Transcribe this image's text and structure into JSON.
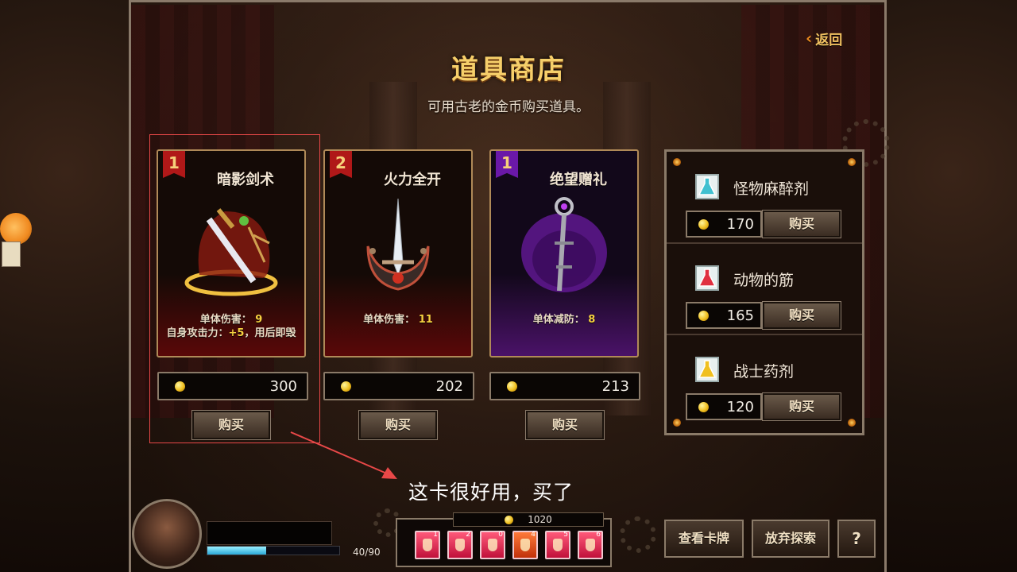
{
  "header": {
    "back_label": "返回",
    "title": "道具商店",
    "subtitle": "可用古老的金币购买道具。"
  },
  "cards": [
    {
      "rank": "1",
      "name": "暗影剑术",
      "theme": "red",
      "desc_line1_label": "单体伤害：",
      "desc_line1_value": "9",
      "desc_line2_label": "自身攻击力：",
      "desc_line2_value": "+5",
      "desc_line2_suffix": "，用后即毁",
      "price": "300",
      "buy_label": "购买",
      "icon": "shadow-sword-icon"
    },
    {
      "rank": "2",
      "name": "火力全开",
      "theme": "red",
      "desc_line1_label": "单体伤害：",
      "desc_line1_value": "11",
      "price": "202",
      "buy_label": "购买",
      "icon": "fire-blade-icon"
    },
    {
      "rank": "1",
      "name": "绝望赠礼",
      "theme": "purple",
      "desc_line1_label": "单体减防：",
      "desc_line1_value": "8",
      "price": "213",
      "buy_label": "购买",
      "icon": "despair-staff-icon"
    }
  ],
  "side_items": [
    {
      "name": "怪物麻醉剂",
      "price": "170",
      "buy_label": "购买",
      "potion_color": "#40c0d0"
    },
    {
      "name": "动物的筋",
      "price": "165",
      "buy_label": "购买",
      "potion_color": "#e03040"
    },
    {
      "name": "战士药剂",
      "price": "120",
      "buy_label": "购买",
      "potion_color": "#f0c020"
    }
  ],
  "annotation": "这卡很好用，买了",
  "player": {
    "hp_current": 40,
    "hp_max": 90,
    "hp_text": "40/90",
    "gold": "1020"
  },
  "slots": [
    {
      "n": "1"
    },
    {
      "n": "2"
    },
    {
      "n": "0"
    },
    {
      "n": "4"
    },
    {
      "n": "5"
    },
    {
      "n": "6"
    }
  ],
  "actions": {
    "view_cards": "查看卡牌",
    "give_up": "放弃探索",
    "help": "?"
  },
  "colors": {
    "accent_gold": "#f6cf6a",
    "rank_red": "#b01818",
    "rank_purple": "#6a18a8",
    "highlight": "#e84848"
  }
}
